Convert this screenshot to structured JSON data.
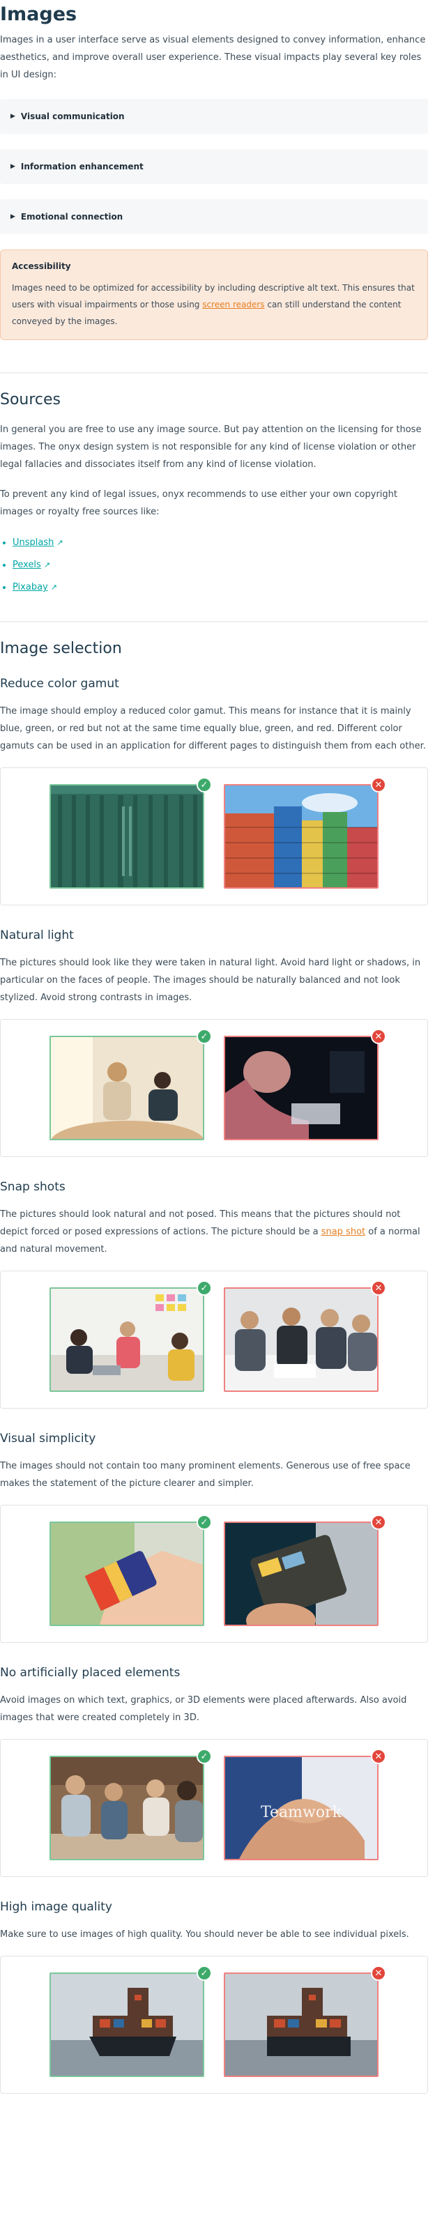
{
  "images": {
    "title": "Images",
    "intro": "Images in a user interface serve as visual elements designed to convey information, enhance aesthetics, and improve overall user experience. These visual impacts play several key roles in UI design:",
    "details": [
      {
        "label": "Visual communication"
      },
      {
        "label": "Information enhancement"
      },
      {
        "label": "Emotional connection"
      }
    ],
    "accessibility": {
      "title": "Accessibility",
      "text_before": "Images need to be optimized for accessibility by including descriptive alt text. This ensures that users with visual impairments or those using ",
      "link": "screen readers",
      "text_after": " can still understand the content conveyed by the images."
    }
  },
  "sources": {
    "title": "Sources",
    "p1": "In general you are free to use any image source. But pay attention on the licensing for those images. The onyx design system is not responsible for any kind of license violation or other legal fallacies and dissociates itself from any kind of license violation.",
    "p2": "To prevent any kind of legal issues, onyx recommends to use either your own copyright images or royalty free sources like:",
    "links": [
      "Unsplash",
      "Pexels",
      "Pixabay"
    ],
    "ext_icon": "↗"
  },
  "selection": {
    "title": "Image selection",
    "ok_icon": "✓",
    "no_icon": "✕",
    "sections": [
      {
        "title": "Reduce color gamut",
        "text": "The image should employ a reduced color gamut. This means for instance that it is mainly blue, green, or red but not at the same time equally blue, green, and red. Different color gamuts can be used in an application for different pages to distinguish them from each other."
      },
      {
        "title": "Natural light",
        "text": "The pictures should look like they were taken in natural light. Avoid hard light or shadows, in particular on the faces of people. The images should be naturally balanced and not look stylized. Avoid strong contrasts in images."
      },
      {
        "title": "Snap shots",
        "text_before": "The pictures should look natural and not posed. This means that the pictures should not depict forced or posed expressions of actions. The picture should be a ",
        "link": "snap shot",
        "text_after": " of a normal and natural movement."
      },
      {
        "title": "Visual simplicity",
        "text": "The images should not contain too many prominent elements. Generous use of free space makes the statement of the picture clearer and simpler."
      },
      {
        "title": "No artificially placed elements",
        "text": "Avoid images on which text, graphics, or 3D elements were placed afterwards. Also avoid images that were created completely in 3D.",
        "bad_overlay": "Teamwork"
      },
      {
        "title": "High image quality",
        "text": "Make sure to use images of high quality. You should never be able to see individual pixels."
      }
    ]
  }
}
